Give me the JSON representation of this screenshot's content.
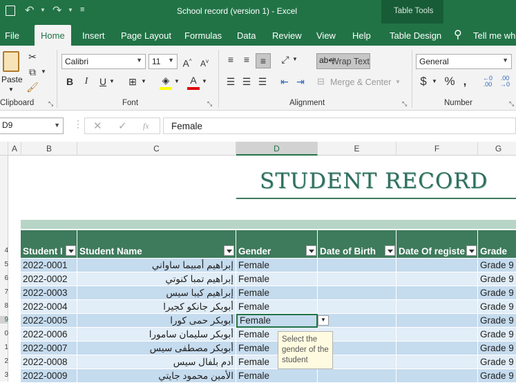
{
  "window": {
    "title": "School record (version 1)  -  Excel",
    "context_label": "Table Tools"
  },
  "tabs": [
    "File",
    "Home",
    "Insert",
    "Page Layout",
    "Formulas",
    "Data",
    "Review",
    "View",
    "Help",
    "Table Design",
    "Tell me wha"
  ],
  "ribbon": {
    "clipboard_label": "Clipboard",
    "paste_label": "Paste",
    "font_label": "Font",
    "font_name": "Calibri",
    "font_size": "11",
    "alignment_label": "Alignment",
    "wrap_text_label": "Wrap Text",
    "merge_center_label": "Merge & Center",
    "number_label": "Number",
    "number_format": "General"
  },
  "formula_bar": {
    "name_box": "D9",
    "value": "Female",
    "fx": "fx"
  },
  "column_headers": [
    "A",
    "B",
    "C",
    "D",
    "E",
    "F",
    "G"
  ],
  "row_numbers": [
    "",
    "",
    "",
    "",
    "4",
    "5",
    "6",
    "7",
    "8",
    "9",
    "0",
    "1",
    "2",
    "3"
  ],
  "sheet": {
    "title": "STUDENT RECORD",
    "table_headers": [
      "Student I",
      "Student Name",
      "Gender",
      "Date of Birth",
      "Date Of registe",
      "Grade"
    ],
    "rows": [
      {
        "id": "2022-0001",
        "name": "إبراهيم أمبيما ساواني",
        "gender": "Female",
        "dob": "",
        "reg": "",
        "grade": "Grade 9"
      },
      {
        "id": "2022-0002",
        "name": "إبراهيم تمبا كنوتي",
        "gender": "Female",
        "dob": "",
        "reg": "",
        "grade": "Grade 9"
      },
      {
        "id": "2022-0003",
        "name": "إبراهيم كيبا سيس",
        "gender": "Female",
        "dob": "",
        "reg": "",
        "grade": "Grade 9"
      },
      {
        "id": "2022-0004",
        "name": "أبوبكر جانكو كجيرا",
        "gender": "Female",
        "dob": "",
        "reg": "",
        "grade": "Grade 9"
      },
      {
        "id": "2022-0005",
        "name": "أبوبكر حمى كورا",
        "gender": "Female",
        "dob": "",
        "reg": "",
        "grade": "Grade 9"
      },
      {
        "id": "2022-0006",
        "name": "أبوبكر سليمان سامورا",
        "gender": "Female",
        "dob": "",
        "reg": "",
        "grade": "Grade 9"
      },
      {
        "id": "2022-0007",
        "name": "أبوبكر مصطفى سيس",
        "gender": "Female",
        "dob": "",
        "reg": "",
        "grade": "Grade 9"
      },
      {
        "id": "2022-0008",
        "name": "أدم بلفال سيس",
        "gender": "Female",
        "dob": "",
        "reg": "",
        "grade": "Grade 9"
      },
      {
        "id": "2022-0009",
        "name": "الأمين محمود جايتي",
        "gender": "Female",
        "dob": "",
        "reg": "",
        "grade": "Grade 9"
      }
    ]
  },
  "tooltip": {
    "text": "Select the gender of the student"
  },
  "colors": {
    "excel_green": "#217346",
    "table_header": "#3e7a5c",
    "band_light": "#c5dbee",
    "band_lighter": "#e1edf7",
    "title_text": "#2e7060"
  }
}
